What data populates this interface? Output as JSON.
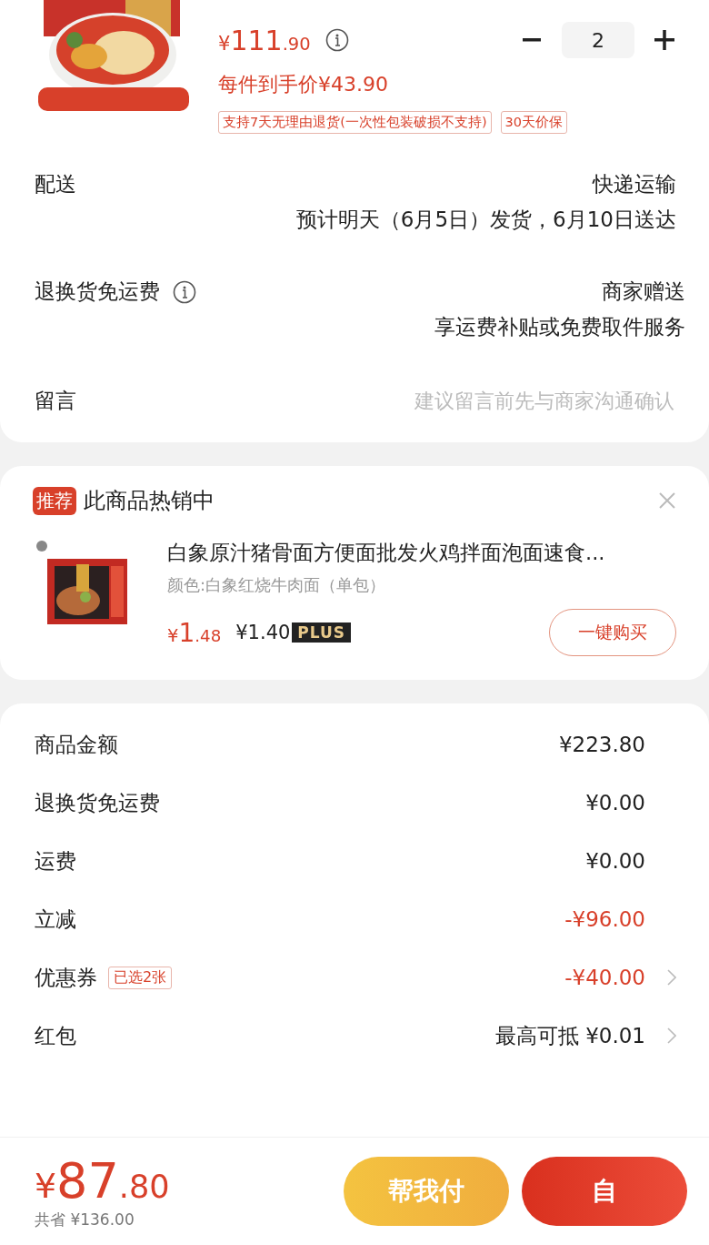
{
  "product": {
    "price": {
      "currency": "¥",
      "integer": "111",
      "decimal": ".90"
    },
    "quantity": "2",
    "per_item": "每件到手价¥43.90",
    "tags": [
      "支持7天无理由退货(一次性包装破损不支持)",
      "30天价保"
    ]
  },
  "details": [
    {
      "label": "配送",
      "info": false,
      "lines": [
        "快递运输",
        "预计明天（6月5日）发货，6月10日送达"
      ]
    },
    {
      "label": "退换货免运费",
      "info": true,
      "lines": [
        "商家赠送",
        "享运费补贴或免费取件服务"
      ]
    }
  ],
  "message": {
    "label": "留言",
    "placeholder": "建议留言前先与商家沟通确认"
  },
  "recommend": {
    "badge": "推荐",
    "title": "此商品热销中",
    "item": {
      "name": "白象原汁猪骨面方便面批发火鸡拌面泡面速食...",
      "spec": "颜色:白象红烧牛肉面（单包）",
      "price": {
        "currency": "¥",
        "integer": "1",
        "decimal": ".48"
      },
      "plus_price": "¥1.40",
      "plus_label": "PLUS",
      "button": "一键购买"
    }
  },
  "summary": [
    {
      "label": "商品金额",
      "value": "¥223.80",
      "highlight": false,
      "chevron": false
    },
    {
      "label": "退换货免运费",
      "value": "¥0.00",
      "highlight": false,
      "chevron": false
    },
    {
      "label": "运费",
      "value": "¥0.00",
      "highlight": false,
      "chevron": false
    },
    {
      "label": "立减",
      "value": "-¥96.00",
      "highlight": true,
      "chevron": false
    },
    {
      "label": "优惠券",
      "tag": "已选2张",
      "value": "-¥40.00",
      "highlight": true,
      "chevron": true
    },
    {
      "label": "红包",
      "value": "最高可抵 ¥0.01",
      "highlight": false,
      "chevron": true
    }
  ],
  "footer": {
    "total": {
      "currency": "¥",
      "integer": "87",
      "decimal": ".80"
    },
    "saved": "共省 ¥136.00",
    "buttons": [
      {
        "label": "帮我付",
        "kind": "secondary"
      },
      {
        "label": "自",
        "kind": "primary"
      }
    ]
  }
}
